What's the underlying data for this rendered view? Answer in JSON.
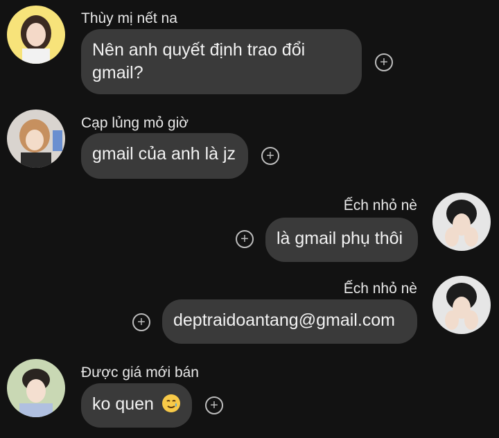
{
  "messages": [
    {
      "sender": "Thùy mị nết na",
      "text_line1": "Nên anh quyết định trao đổi",
      "text_line2": "gmail?",
      "side": "left"
    },
    {
      "sender": "Cạp lủng mỏ giờ",
      "text": "gmail của anh là jz",
      "side": "left"
    },
    {
      "sender": "Ếch nhỏ nè",
      "text": "là gmail phụ thôi",
      "side": "right"
    },
    {
      "sender": "Ếch nhỏ nè",
      "text": "deptraidoantang@gmail.com",
      "side": "right"
    },
    {
      "sender": "Được giá mới bán",
      "text": "ko quen",
      "emoji": "smiling-face-with-tear",
      "side": "left"
    }
  ],
  "icons": {
    "reaction": "add-reaction-icon"
  },
  "colors": {
    "background": "#121212",
    "bubble": "#3a3a3a",
    "text": "#f2f2f2"
  }
}
